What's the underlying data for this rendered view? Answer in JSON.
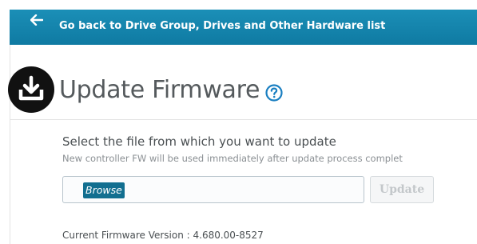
{
  "topbar": {
    "back_label": "Go back to Drive Group, Drives and Other Hardware list",
    "back_icon": "arrow-left-icon",
    "background_color": "#1485ad"
  },
  "header": {
    "title": "Update Firmware",
    "title_icon": "firmware-download-icon",
    "help_icon": "help-circle-icon",
    "help_icon_color": "#1a7fc1"
  },
  "update_form": {
    "heading": "Select the file from which you want to update",
    "subheading": "New controller FW will be used immediately after update process complet",
    "browse_label": "Browse",
    "update_label": "Update",
    "update_enabled": false
  },
  "status": {
    "firmware_version_text": "Current Firmware Version : 4.680.00-8527"
  }
}
